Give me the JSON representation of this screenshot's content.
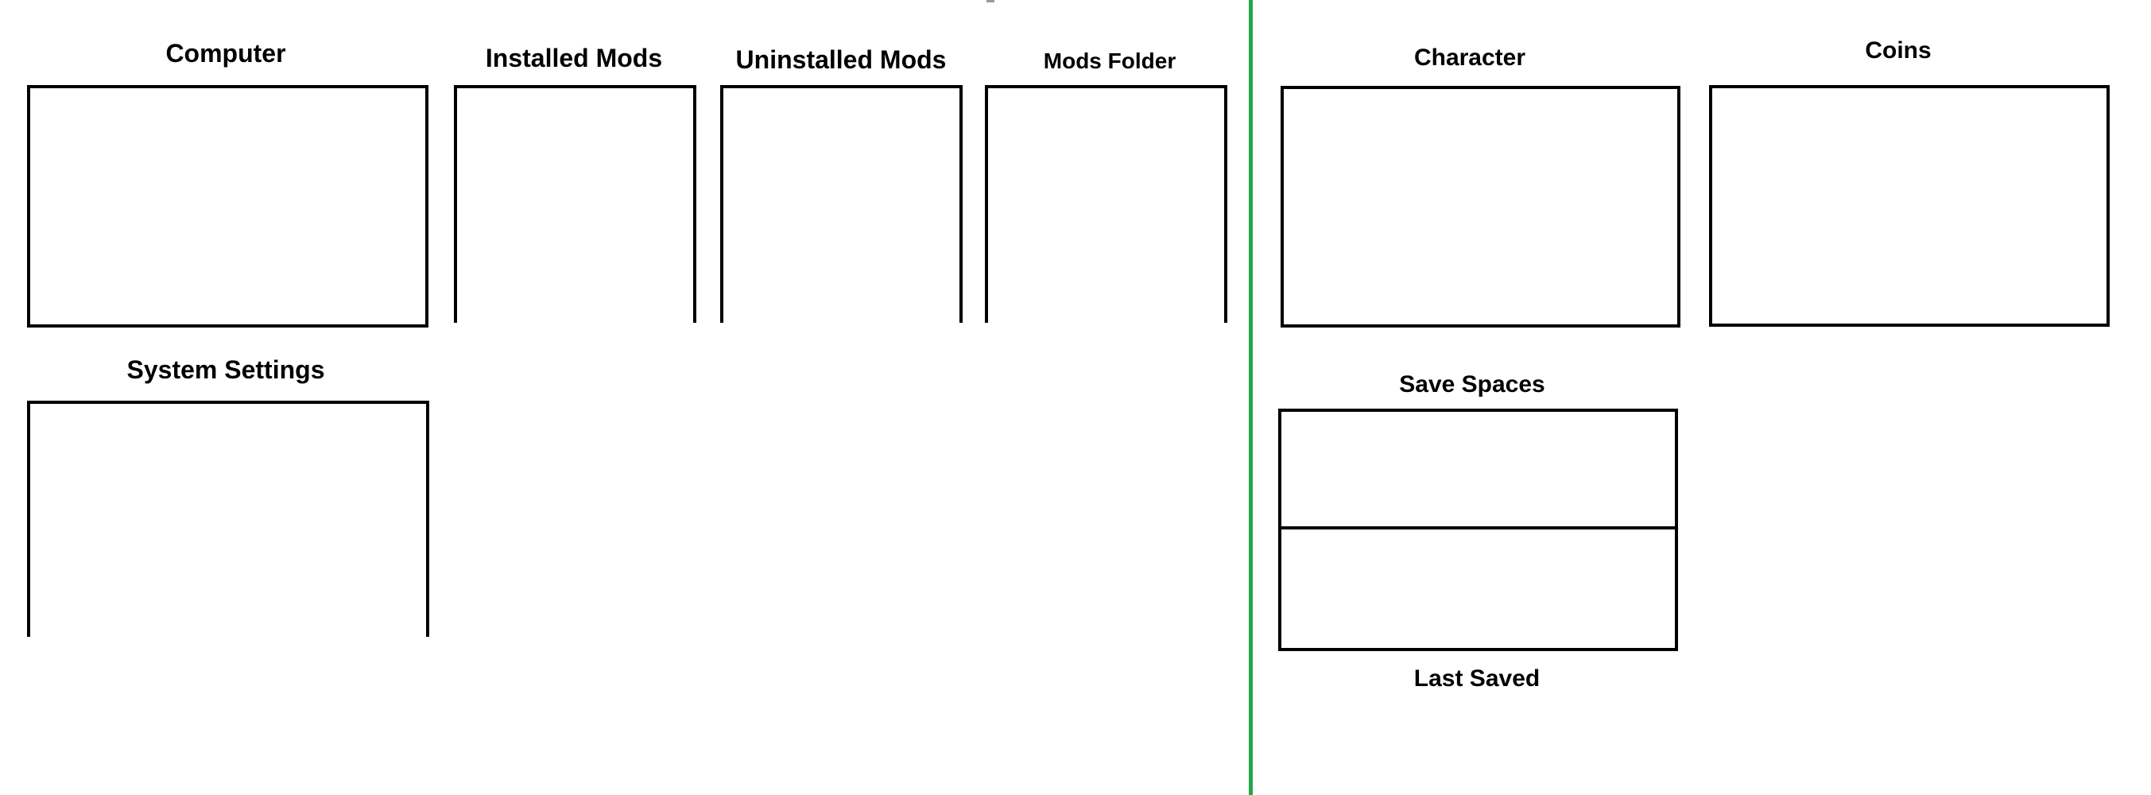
{
  "colors": {
    "divider": "#22a64a",
    "outline": "#000000",
    "background": "#ffffff"
  },
  "left_panel": {
    "computer": {
      "label": "Computer"
    },
    "installed_mods": {
      "label": "Installed Mods"
    },
    "uninstalled_mods": {
      "label": "Uninstalled Mods"
    },
    "mods_folder": {
      "label": "Mods Folder"
    },
    "system_settings": {
      "label": "System Settings"
    }
  },
  "right_panel": {
    "character": {
      "label": "Character"
    },
    "coins": {
      "label": "Coins"
    },
    "save_spaces": {
      "label": "Save Spaces"
    },
    "last_saved": {
      "label": "Last Saved"
    }
  }
}
